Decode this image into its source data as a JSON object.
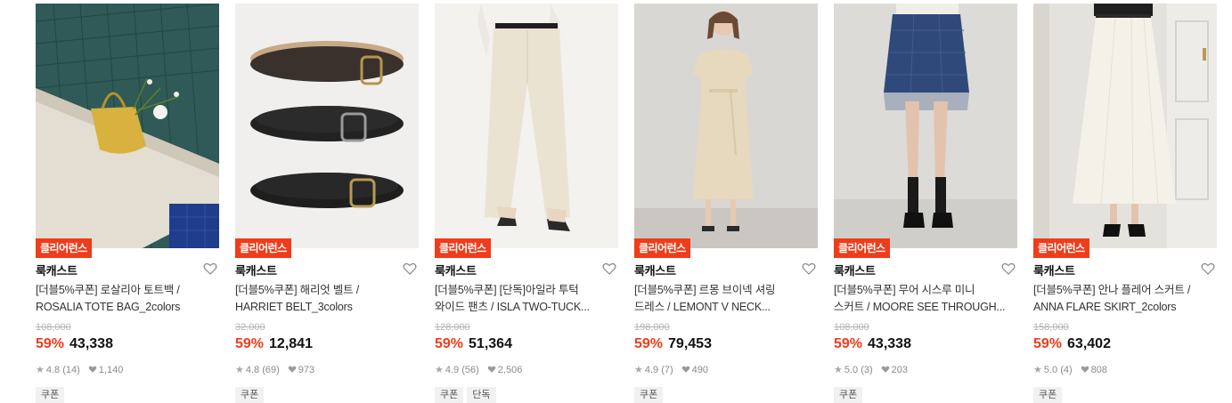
{
  "products": [
    {
      "badge": "클리어런스",
      "brand": "룩캐스트",
      "title": "[더블5%쿠폰] 로살리아 토트백 /\nROSALIA TOTE BAG_2colors",
      "original_price": "108,000",
      "discount": "59%",
      "price": "43,338",
      "rating": "4.8 (14)",
      "likes": "1,140",
      "tags": [
        "쿠폰"
      ],
      "image_icon": "tote-bag-image"
    },
    {
      "badge": "클리어런스",
      "brand": "룩캐스트",
      "title": "[더블5%쿠폰] 해리엇 벨트 /\nHARRIET BELT_3colors",
      "original_price": "32,000",
      "discount": "59%",
      "price": "12,841",
      "rating": "4.8 (69)",
      "likes": "973",
      "tags": [
        "쿠폰"
      ],
      "image_icon": "belts-image"
    },
    {
      "badge": "클리어런스",
      "brand": "룩캐스트",
      "title": "[더블5%쿠폰] [단독]아일라 투턱\n와이드 팬츠 / ISLA TWO-TUCK...",
      "original_price": "128,000",
      "discount": "59%",
      "price": "51,364",
      "rating": "4.9 (56)",
      "likes": "2,506",
      "tags": [
        "쿠폰",
        "단독"
      ],
      "image_icon": "wide-pants-image"
    },
    {
      "badge": "클리어런스",
      "brand": "룩캐스트",
      "title": "[더블5%쿠폰] 르몽 브이넥 셔링\n드레스 / LEMONT V NECK...",
      "original_price": "198,000",
      "discount": "59%",
      "price": "79,453",
      "rating": "4.9 (7)",
      "likes": "490",
      "tags": [
        "쿠폰"
      ],
      "image_icon": "dress-image"
    },
    {
      "badge": "클리어런스",
      "brand": "룩캐스트",
      "title": "[더블5%쿠폰] 무어 시스루 미니\n스커트 / MOORE SEE THROUGH...",
      "original_price": "108,000",
      "discount": "59%",
      "price": "43,338",
      "rating": "5.0 (3)",
      "likes": "203",
      "tags": [
        "쿠폰"
      ],
      "image_icon": "mini-skirt-image"
    },
    {
      "badge": "클리어런스",
      "brand": "룩캐스트",
      "title": "[더블5%쿠폰] 안나 플레어 스커트 /\nANNA FLARE SKIRT_2colors",
      "original_price": "158,000",
      "discount": "59%",
      "price": "63,402",
      "rating": "5.0 (4)",
      "likes": "808",
      "tags": [
        "쿠폰"
      ],
      "image_icon": "flare-skirt-image"
    }
  ],
  "colors": {
    "accent": "#ef3c1b",
    "muted": "#8a8a8a",
    "tag_bg": "#f1f1f1"
  }
}
